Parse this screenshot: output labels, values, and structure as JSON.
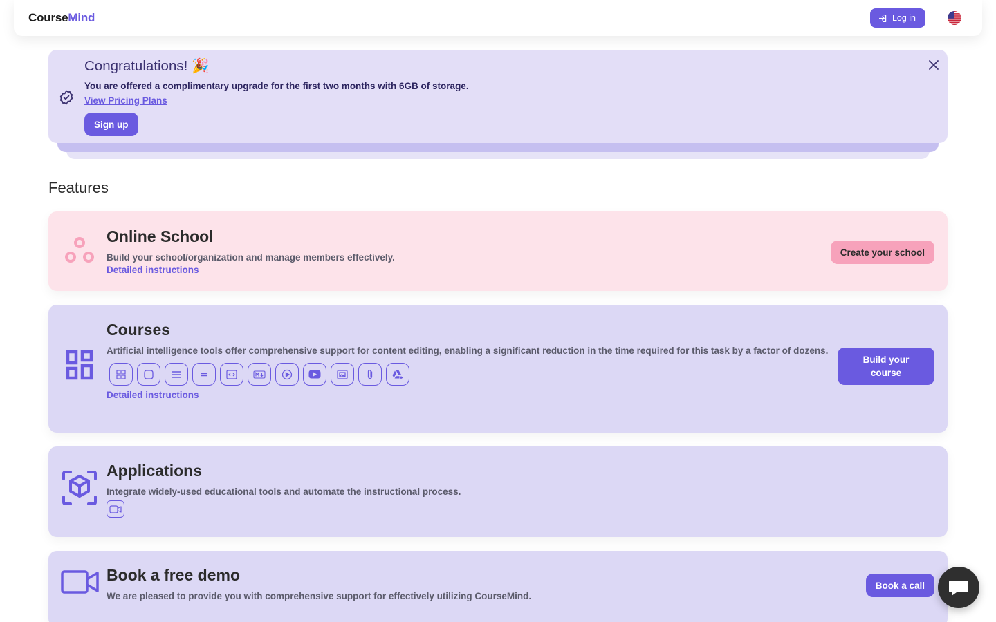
{
  "header": {
    "logo_part1": "Course",
    "logo_part2": "Mind",
    "login_label": "Log in",
    "language_flag": "us-flag"
  },
  "promo": {
    "title": "Congratulations! 🎉",
    "message": "You are offered a complimentary upgrade for the first two months with 6GB of storage.",
    "link": "View Pricing Plans",
    "signup": "Sign up"
  },
  "features": {
    "heading": "Features",
    "school": {
      "title": "Online School",
      "description": "Build your school/organization and manage members effectively.",
      "instructions": "Detailed instructions",
      "action": "Create your school"
    },
    "courses": {
      "title": "Courses",
      "description": "Artificial intelligence tools offer comprehensive support for content editing, enabling a significant reduction in the time required for this task by a factor of dozens.",
      "instructions": "Detailed instructions",
      "action": "Build your course",
      "tools": [
        "grid-icon",
        "square-icon",
        "lines-icon",
        "divider-icon",
        "code-icon",
        "markdown-icon",
        "play-icon",
        "youtube-icon",
        "image-icon",
        "attachment-icon",
        "drive-icon"
      ]
    },
    "apps": {
      "title": "Applications",
      "description": "Integrate widely-used educational tools and automate the instructional process.",
      "tools": [
        "video-camera-icon"
      ]
    },
    "demo": {
      "title": "Book a free demo",
      "description": "We are pleased to provide you with comprehensive support for effectively utilizing CourseMind.",
      "action": "Book a call"
    }
  },
  "colors": {
    "accent": "#6a5ae0",
    "pink_card": "#fde3ea",
    "pink_button": "#f7a2bb",
    "lavender_card": "#dcd8f5",
    "promo_bg": "#e3def7"
  }
}
